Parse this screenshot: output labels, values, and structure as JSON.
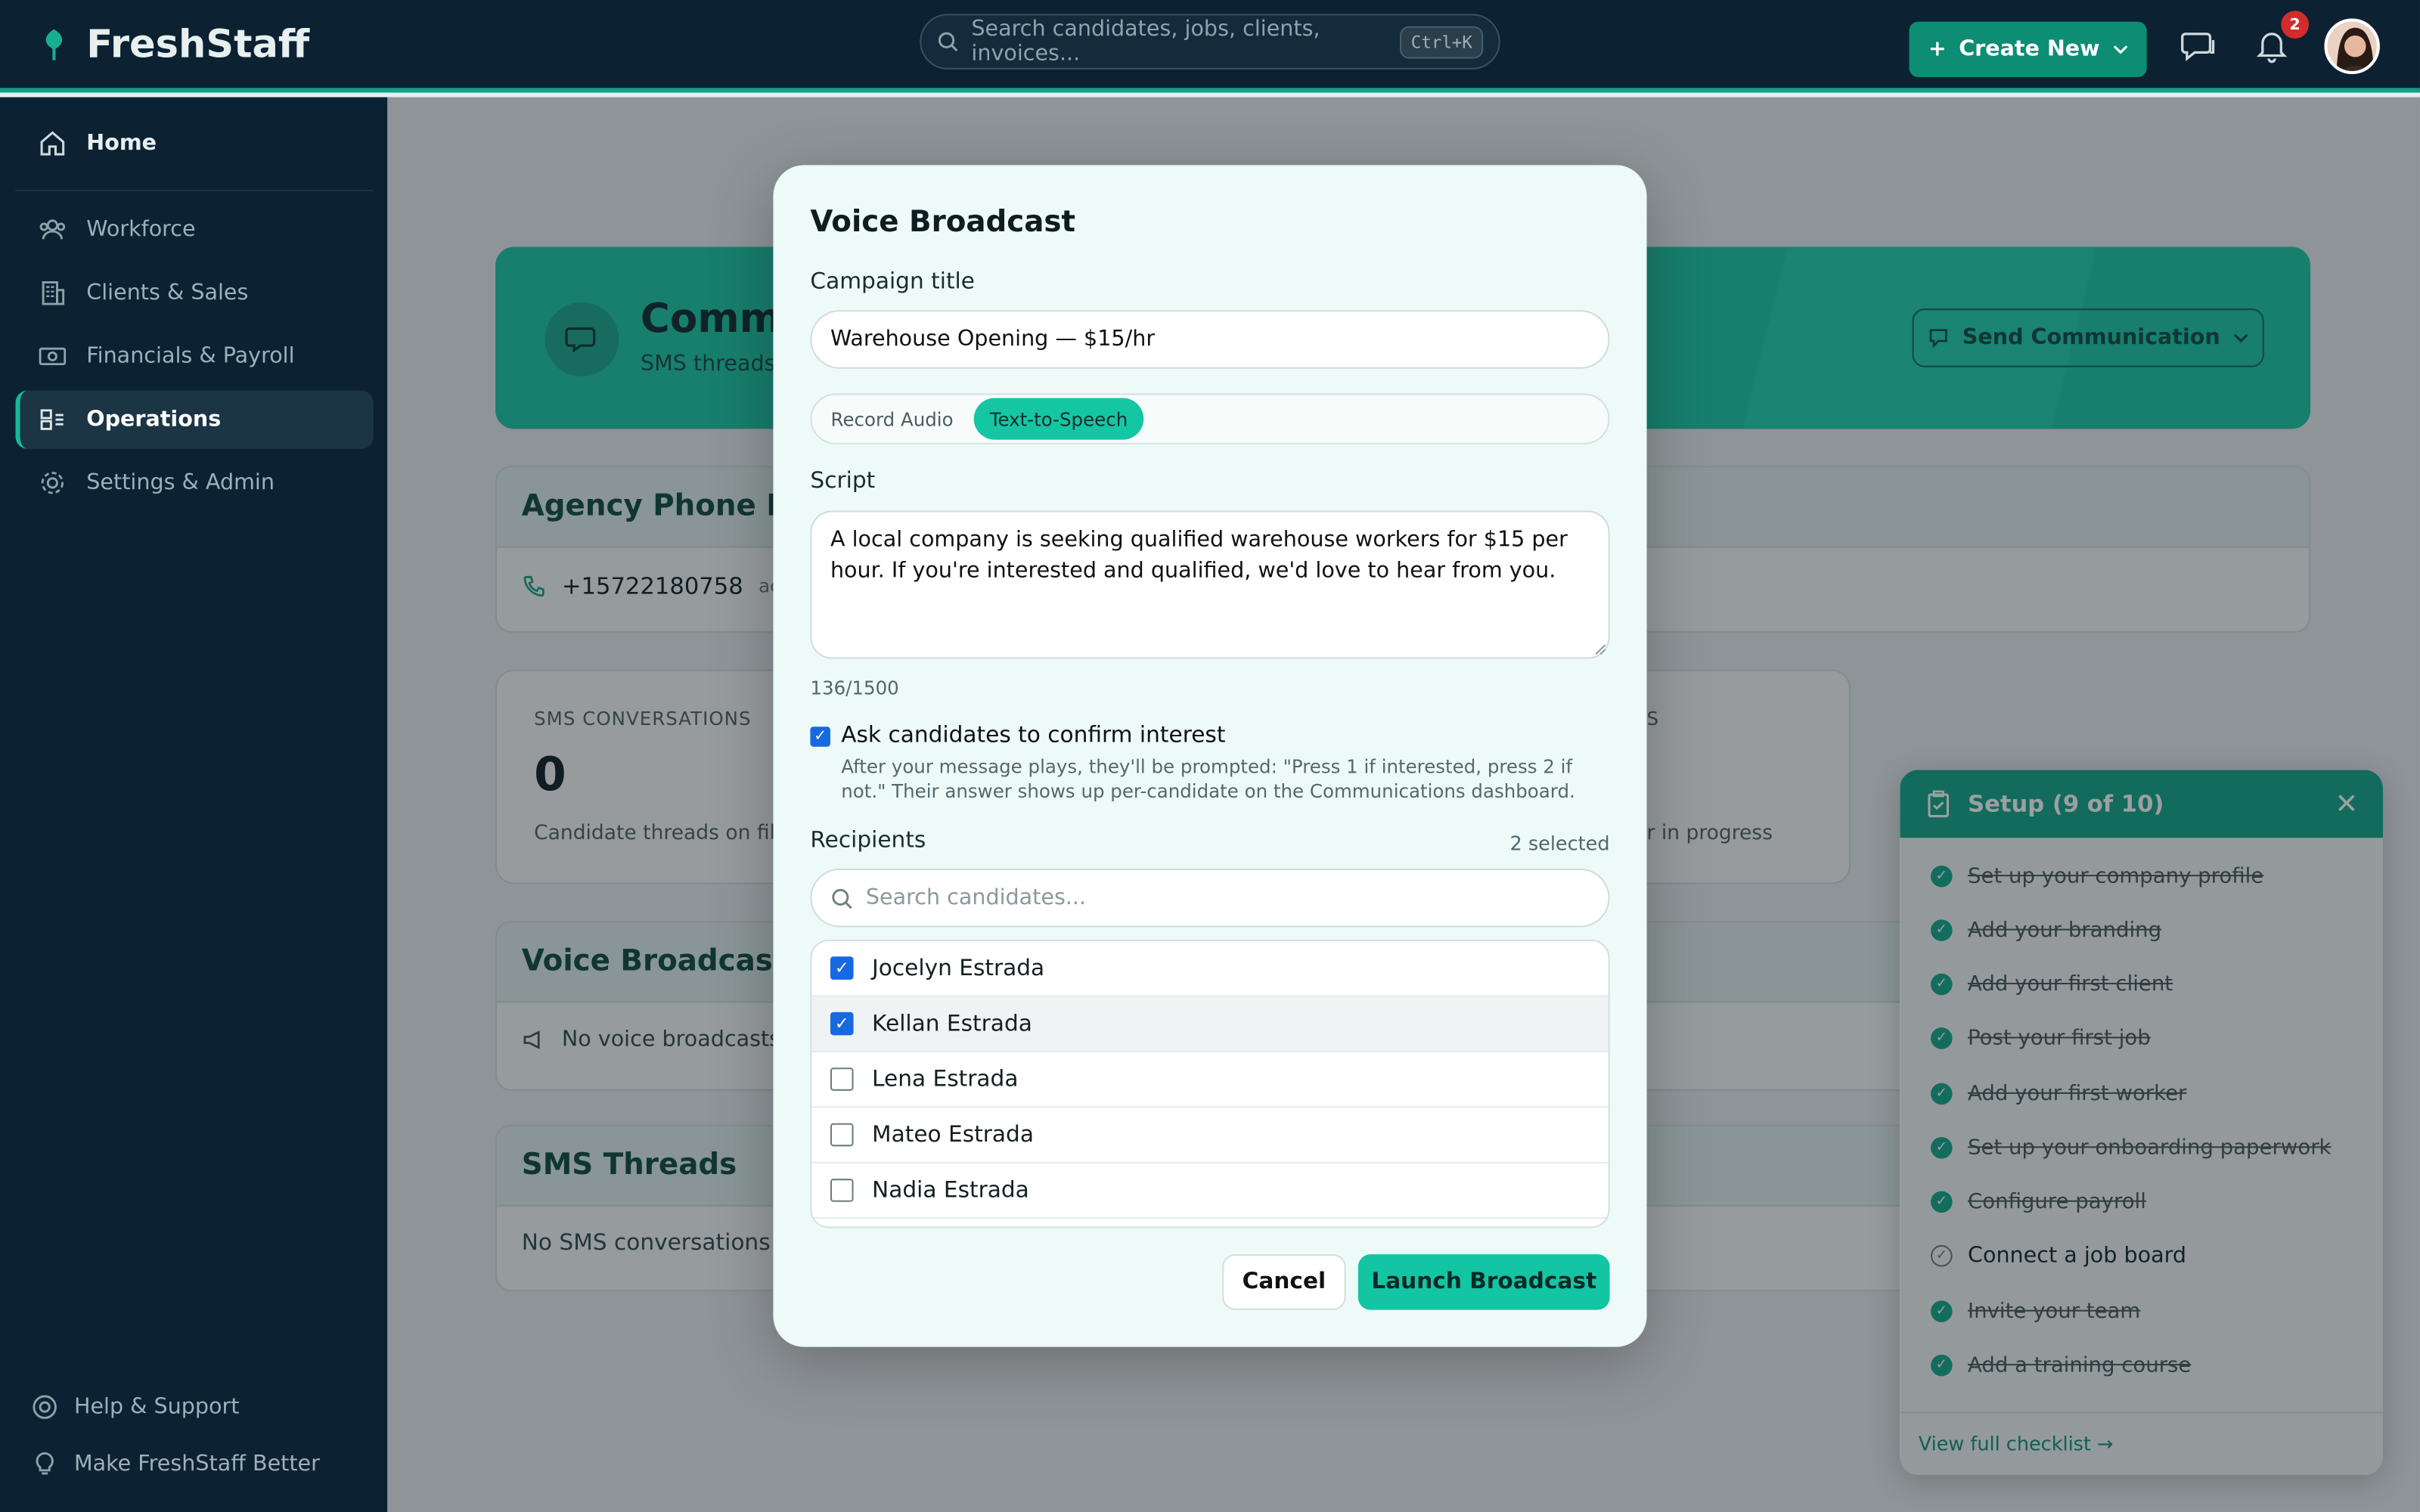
{
  "app": {
    "brand": "FreshStaff",
    "search_placeholder": "Search candidates, jobs, clients, invoices...",
    "search_shortcut": "Ctrl+K",
    "create_label": "Create New",
    "notification_count": "2",
    "accent_color": "#12a085"
  },
  "sidebar": {
    "items": [
      {
        "label": "Home",
        "icon": "home-icon"
      },
      {
        "label": "Workforce",
        "icon": "people-icon"
      },
      {
        "label": "Clients & Sales",
        "icon": "building-icon"
      },
      {
        "label": "Financials & Payroll",
        "icon": "money-icon"
      },
      {
        "label": "Operations",
        "icon": "operations-icon",
        "active": true
      },
      {
        "label": "Settings & Admin",
        "icon": "gear-icon"
      }
    ],
    "footer": [
      {
        "label": "Help & Support",
        "icon": "lifebuoy-icon"
      },
      {
        "label": "Make FreshStaff Better",
        "icon": "lightbulb-icon"
      }
    ]
  },
  "page": {
    "hero_title": "Commu",
    "hero_subtitle": "SMS threads",
    "send_label": "Send Communication",
    "phone_card_title": "Agency Phone Nu",
    "phone_number": "+15722180758",
    "phone_status": "activ",
    "stat1_label": "SMS CONVERSATIONS",
    "stat1_value": "0",
    "stat1_sub": "Candidate threads on file",
    "stat2_label_fragment": "S",
    "stat2_sub_fragment": "r in progress",
    "voice_card_title": "Voice Broadcasts",
    "voice_empty": "No voice broadcasts",
    "sms_card_title": "SMS Threads",
    "sms_empty": "No SMS conversations ye"
  },
  "setup": {
    "title": "Setup (9 of 10)",
    "items": [
      {
        "label": "Set up your company profile",
        "done": true
      },
      {
        "label": "Add your branding",
        "done": true
      },
      {
        "label": "Add your first client",
        "done": true
      },
      {
        "label": "Post your first job",
        "done": true
      },
      {
        "label": "Add your first worker",
        "done": true
      },
      {
        "label": "Set up your onboarding paperwork",
        "done": true
      },
      {
        "label": "Configure payroll",
        "done": true
      },
      {
        "label": "Connect a job board",
        "done": false
      },
      {
        "label": "Invite your team",
        "done": true
      },
      {
        "label": "Add a training course",
        "done": true
      }
    ],
    "footer_link": "View full checklist →"
  },
  "modal": {
    "title": "Voice Broadcast",
    "campaign_label": "Campaign title",
    "campaign_value": "Warehouse Opening — $15/hr",
    "mode_options": [
      "Record Audio",
      "Text-to-Speech"
    ],
    "mode_selected": "Text-to-Speech",
    "script_label": "Script",
    "script_value": "A local company is seeking qualified warehouse workers for $15 per hour. If you're interested and qualified, we'd love to hear from you.",
    "char_count": "136/1500",
    "confirm_label": "Ask candidates to confirm interest",
    "confirm_checked": true,
    "confirm_hint": "After your message plays, they'll be prompted: \"Press 1 if interested, press 2 if not.\" Their answer shows up per-candidate on the Communications dashboard.",
    "recipients_label": "Recipients",
    "selected_count": "2 selected",
    "recipient_search_placeholder": "Search candidates...",
    "recipients": [
      {
        "name": "Jocelyn Estrada",
        "checked": true
      },
      {
        "name": "Kellan Estrada",
        "checked": true
      },
      {
        "name": "Lena Estrada",
        "checked": false
      },
      {
        "name": "Mateo Estrada",
        "checked": false
      },
      {
        "name": "Nadia Estrada",
        "checked": false
      }
    ],
    "cancel_label": "Cancel",
    "launch_label": "Launch Broadcast"
  }
}
